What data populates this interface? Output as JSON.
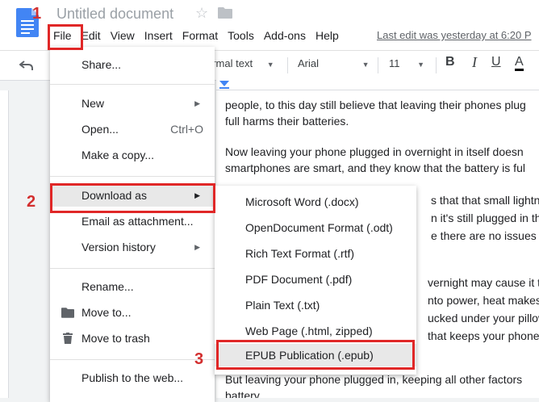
{
  "header": {
    "title": "Untitled document",
    "menu": [
      "File",
      "Edit",
      "View",
      "Insert",
      "Format",
      "Tools",
      "Add-ons",
      "Help"
    ],
    "last_edit": "Last edit was yesterday at 6:20 P"
  },
  "toolbar": {
    "style": "ormal text",
    "font": "Arial",
    "size": "11",
    "bold": "B",
    "italic": "I",
    "underline": "U",
    "text_color": "A"
  },
  "document": {
    "lines": [
      "people,  to this day still believe that leaving their phones plug",
      "full harms their batteries.",
      "Now leaving your phone plugged in overnight  in itself doesn",
      "smartphones are smart, and they know that the battery is ful",
      "s that that small lightnin",
      "n it's still plugged in that",
      "e there are no issues of",
      "vernight may cause it to",
      "nto power, heat makes",
      "ucked under your pillow",
      "that keeps your phone v",
      "But leaving your phone plugged in, keeping all other factors",
      "battery."
    ]
  },
  "file_menu": {
    "share": "Share...",
    "new": "New",
    "open": "Open...",
    "open_shortcut": "Ctrl+O",
    "make_copy": "Make a copy...",
    "download_as": "Download as",
    "email_attachment": "Email as attachment...",
    "version_history": "Version history",
    "rename": "Rename...",
    "move_to": "Move to...",
    "move_to_trash": "Move to trash",
    "publish": "Publish to the web..."
  },
  "download_submenu": [
    "Microsoft Word (.docx)",
    "OpenDocument Format (.odt)",
    "Rich Text Format (.rtf)",
    "PDF Document (.pdf)",
    "Plain Text (.txt)",
    "Web Page (.html, zipped)",
    "EPUB Publication (.epub)"
  ],
  "annotations": [
    "1",
    "2",
    "3"
  ],
  "colors": {
    "annotation": "#e02727",
    "docs_blue": "#4285f4",
    "highlight": "#e8e8e8"
  }
}
